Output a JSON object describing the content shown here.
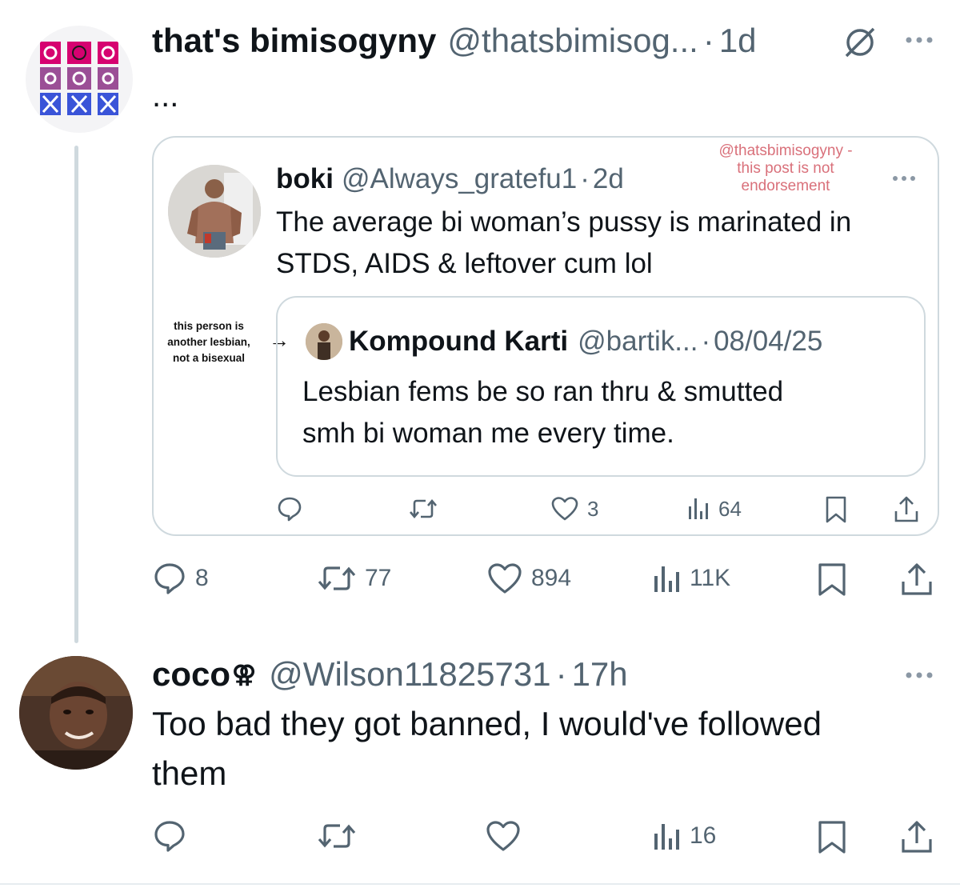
{
  "main_post": {
    "display_name": "that's bimisogyny",
    "handle": "@thatsbimisog...",
    "separator": "·",
    "time": "1d",
    "body": "...",
    "avatar_icon": "bi-flag-pattern-avatar",
    "muted_icon": "no-symbol-icon",
    "more_icon": "more-icon",
    "stats": {
      "replies": "8",
      "reposts": "77",
      "likes": "894",
      "views": "11K"
    }
  },
  "quoted_post": {
    "display_name": "boki",
    "handle": "@Always_gratefu1",
    "separator": "·",
    "time": "2d",
    "text_line1": "The average bi woman’s pussy is marinated in",
    "text_line2": "STDS, AIDS & leftover cum lol",
    "watermark_line1": "@thatsbimisogyny -",
    "watermark_line2": "this post is not",
    "watermark_line3": "endorsement",
    "stats": {
      "likes": "3",
      "views": "64"
    }
  },
  "nested_quote": {
    "display_name": "Kompound Karti",
    "handle": "@bartik...",
    "separator": "·",
    "time": "08/04/25",
    "text_line1": "Lesbian fems be so ran thru & smutted",
    "text_line2": "smh bi woman me every time."
  },
  "annotation": {
    "line1": "this person is",
    "line2": "another lesbian,",
    "line3": "not a bisexual",
    "arrow": "→"
  },
  "reply": {
    "display_name": "coco",
    "name_emoji": "⚢",
    "handle": "@Wilson11825731",
    "separator": "·",
    "time": "17h",
    "text_line1": "Too bad they got banned, I would've followed",
    "text_line2": "them",
    "stats": {
      "views": "16"
    }
  },
  "colors": {
    "text": "#0f1419",
    "secondary": "#536471",
    "border": "#cfd9de",
    "thread_line": "#cfd9de",
    "watermark": "#d9707a",
    "bi_pink": "#d60270",
    "bi_purple": "#9b4f96",
    "bi_blue": "#0038a8"
  }
}
